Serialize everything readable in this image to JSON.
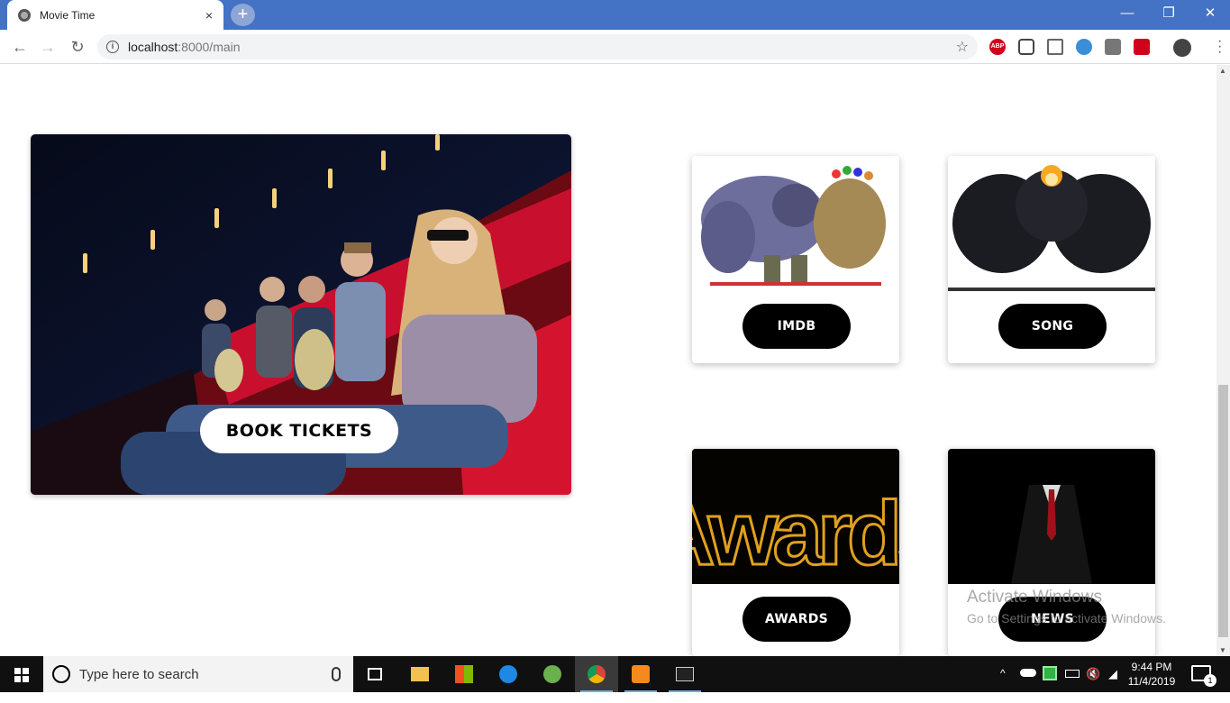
{
  "browser": {
    "tab_title": "Movie Time",
    "tab_close": "×",
    "new_tab": "+",
    "url_host": "localhost",
    "url_path": ":8000/main",
    "extension_abp": "ABP",
    "window_controls": {
      "minimize": "—",
      "restore": "❐",
      "close": "✕"
    }
  },
  "page": {
    "hero_button": "BOOK TICKETS",
    "cards": [
      {
        "label": "IMDB"
      },
      {
        "label": "SONG"
      },
      {
        "label": "AWARDS",
        "image_text": "Awards"
      },
      {
        "label": "NEWS"
      }
    ]
  },
  "watermark": {
    "line1": "Activate Windows",
    "line2": "Go to Settings to activate Windows."
  },
  "taskbar": {
    "search_placeholder": "Type here to search",
    "time": "9:44 PM",
    "date": "11/4/2019",
    "notifications": "1"
  },
  "colors": {
    "titlebar": "#4472c4",
    "pill_dark": "#000000",
    "seat_red": "#c8102e"
  }
}
